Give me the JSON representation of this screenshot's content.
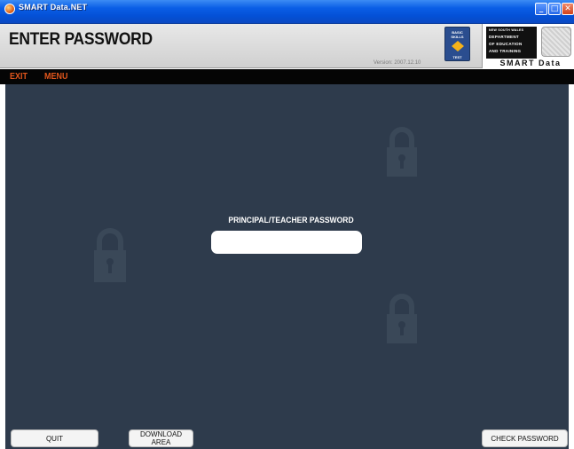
{
  "window": {
    "title": "SMART Data.NET",
    "min_glyph": "_",
    "max_glyph": "□",
    "close_glyph": "✕"
  },
  "header": {
    "page_title": "ENTER PASSWORD",
    "version": "Version: 2007.12.10",
    "bnt_badge": [
      "BASIC",
      "SKILLS",
      "TEST"
    ],
    "department": [
      "NEW SOUTH WALES",
      "DEPARTMENT",
      "OF EDUCATION",
      "AND TRAINING"
    ],
    "product_name": "SMART Data"
  },
  "menu": {
    "exit_label": "EXIT",
    "menu_label": "MENU",
    "accent_color": "#e2561c"
  },
  "main": {
    "background_color": "#2e3b4c",
    "password_label": "PRINCIPAL/TEACHER PASSWORD",
    "password_value": "",
    "decor_icon": "lock-icon"
  },
  "footer": {
    "quit_label": "QUIT",
    "download_label": "DOWNLOAD AREA",
    "check_label": "CHECK PASSWORD"
  }
}
